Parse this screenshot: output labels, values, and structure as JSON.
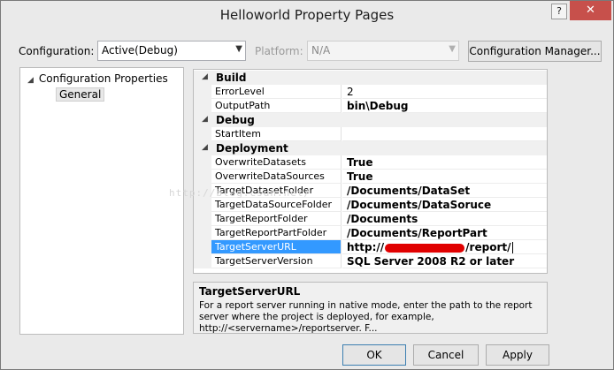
{
  "window": {
    "title": "Helloworld Property Pages",
    "help_glyph": "?",
    "close_glyph": "✕"
  },
  "configuration": {
    "label": "Configuration:",
    "value": "Active(Debug)"
  },
  "platform": {
    "label": "Platform:",
    "value": "N/A"
  },
  "config_manager_label": "Configuration Manager...",
  "tree": {
    "root_label": "Configuration Properties",
    "child_label": "General"
  },
  "properties": {
    "build": {
      "label": "Build",
      "error_level": {
        "name": "ErrorLevel",
        "value": "2"
      },
      "output_path": {
        "name": "OutputPath",
        "value": "bin\\Debug"
      }
    },
    "debug": {
      "label": "Debug",
      "start_item": {
        "name": "StartItem",
        "value": ""
      }
    },
    "deployment": {
      "label": "Deployment",
      "overwrite_datasets": {
        "name": "OverwriteDatasets",
        "value": "True"
      },
      "overwrite_datasources": {
        "name": "OverwriteDataSources",
        "value": "True"
      },
      "target_dataset_folder": {
        "name": "TargetDatasetFolder",
        "value": "/Documents/DataSet"
      },
      "target_datasource_folder": {
        "name": "TargetDataSourceFolder",
        "value": "/Documents/DataSoruce"
      },
      "target_report_folder": {
        "name": "TargetReportFolder",
        "value": "/Documents"
      },
      "target_reportpart_folder": {
        "name": "TargetReportPartFolder",
        "value": "/Documents/ReportPart"
      },
      "target_server_url": {
        "name": "TargetServerURL",
        "value_prefix": "http://",
        "value_suffix": "/report/"
      },
      "target_server_version": {
        "name": "TargetServerVersion",
        "value": "SQL Server 2008 R2 or later"
      }
    }
  },
  "description": {
    "title": "TargetServerURL",
    "text": "For a report server running in native mode, enter the path to the report server where the project is deployed, for example, http://<servername>/reportserver. F..."
  },
  "watermark": "http://blog.csdn.net/",
  "buttons": {
    "ok": "OK",
    "cancel": "Cancel",
    "apply": "Apply"
  },
  "colors": {
    "selection": "#3399ff",
    "close": "#c7504b",
    "redaction": "#e00000"
  }
}
